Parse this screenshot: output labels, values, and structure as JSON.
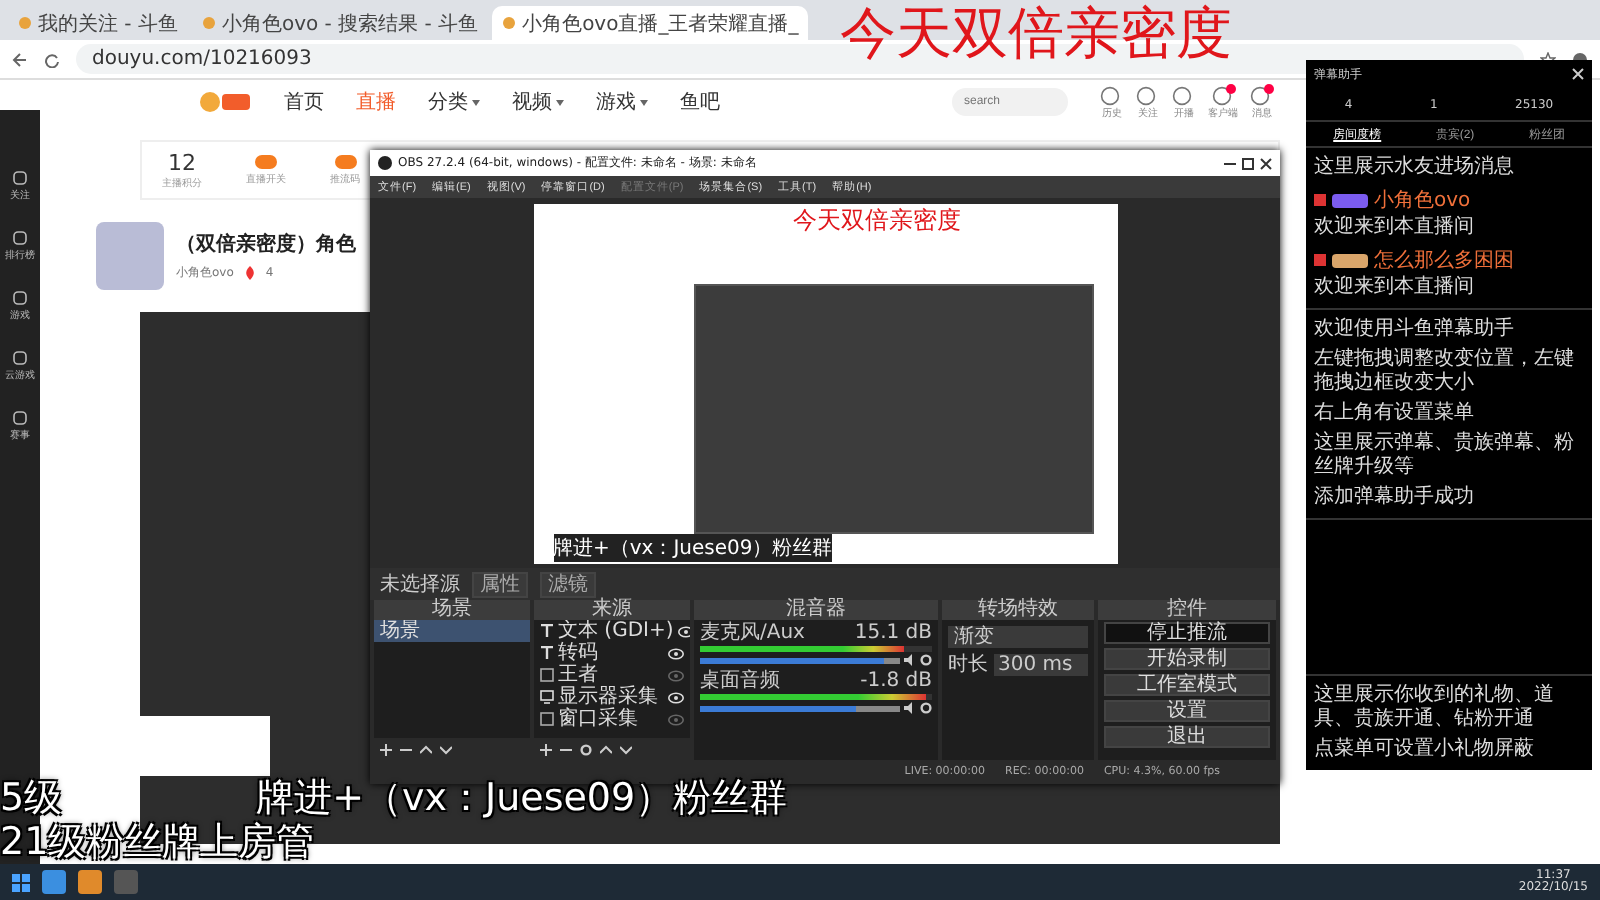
{
  "browser": {
    "tabs": [
      {
        "label": "我的关注 - 斗鱼",
        "selected": false
      },
      {
        "label": "小角色ovo - 搜索结果 - 斗鱼",
        "selected": false
      },
      {
        "label": "小角色ovo直播_王者荣耀直播_",
        "selected": true
      }
    ],
    "address": "douyu.com/10216093"
  },
  "overlay_title": "今天双倍亲密度",
  "site": {
    "nav": [
      {
        "label": "首页",
        "selected": false,
        "kind": "link"
      },
      {
        "label": "直播",
        "selected": true,
        "kind": "link"
      },
      {
        "label": "分类",
        "selected": false,
        "kind": "menu"
      },
      {
        "label": "视频",
        "selected": false,
        "kind": "menu"
      },
      {
        "label": "游戏",
        "selected": false,
        "kind": "menu"
      },
      {
        "label": "鱼吧",
        "selected": false,
        "kind": "link"
      }
    ],
    "search": {
      "placeholder": "search"
    },
    "header_icons": [
      {
        "label": "历史",
        "badge": false
      },
      {
        "label": "关注",
        "badge": false
      },
      {
        "label": "开播",
        "badge": false
      },
      {
        "label": "客户端",
        "badge": true
      },
      {
        "label": "消息",
        "badge": true
      }
    ],
    "sidebar": [
      "关注",
      "排行榜",
      "游戏",
      "云游戏",
      "赛事"
    ],
    "score": {
      "value": "12",
      "label": "主播积分"
    },
    "tools": [
      "直播开关",
      "推流码"
    ],
    "streamer": {
      "title": "（双倍亲密度）角色",
      "name": "小角色ovo",
      "hot": "4"
    }
  },
  "chat": {
    "title": "弹幕助手",
    "stats": [
      "4",
      "1",
      "25130"
    ],
    "tabs": [
      {
        "label": "房间度榜",
        "selected": true
      },
      {
        "label": "贵宾(2)",
        "selected": false
      },
      {
        "label": "粉丝团",
        "selected": false
      }
    ],
    "enter_header": "这里展示水友进场消息",
    "entries": [
      {
        "user": "小角色ovo",
        "text": "欢迎来到本直播间",
        "color": "#7b5cf0"
      },
      {
        "user": "怎么那么多困困",
        "text": "欢迎来到本直播间",
        "color": "#d9a56a"
      }
    ],
    "system": [
      "欢迎使用斗鱼弹幕助手",
      "左键拖拽调整改变位置，左键拖拽边框改变大小",
      "右上角有设置菜单",
      "这里展示弹幕、贵族弹幕、粉丝牌升级等",
      "添加弹幕助手成功"
    ],
    "gifts": [
      "这里展示你收到的礼物、道具、贵族开通、钻粉开通",
      "点菜单可设置小礼物屏蔽"
    ]
  },
  "obs": {
    "title": "OBS 27.2.4 (64-bit, windows) - 配置文件: 未命名 - 场景: 未命名",
    "menu": [
      {
        "label": "文件(F)",
        "disabled": false
      },
      {
        "label": "编辑(E)",
        "disabled": false
      },
      {
        "label": "视图(V)",
        "disabled": false
      },
      {
        "label": "停靠窗口(D)",
        "disabled": false
      },
      {
        "label": "配置文件(P)",
        "disabled": true
      },
      {
        "label": "场景集合(S)",
        "disabled": false
      },
      {
        "label": "工具(T)",
        "disabled": false
      },
      {
        "label": "帮助(H)",
        "disabled": false
      }
    ],
    "preview_texts": [
      "今天双倍亲密度",
      "牌进+（vx：Juese09）粉丝群"
    ],
    "no_source": "未选择源",
    "source_buttons": [
      "属性",
      "滤镜"
    ],
    "docks": [
      "场景",
      "来源",
      "混音器",
      "转场特效",
      "控件"
    ],
    "scenes": [
      {
        "label": "场景",
        "selected": true
      }
    ],
    "sources": [
      {
        "label": "文本 (GDI+)",
        "kind": "text",
        "visible": true
      },
      {
        "label": "转码",
        "kind": "text",
        "visible": true
      },
      {
        "label": "王者",
        "kind": "window",
        "visible": false
      },
      {
        "label": "显示器采集",
        "kind": "monitor",
        "visible": true
      },
      {
        "label": "窗口采集",
        "kind": "window",
        "visible": false
      }
    ],
    "mixer": [
      {
        "name": "麦克风/Aux",
        "reading": "15.1 dB",
        "meter": {
          "level": 0.88
        },
        "volume": {
          "level": 0.92
        }
      },
      {
        "name": "桌面音频",
        "reading": "-1.8 dB",
        "meter": {
          "level": 0.97
        },
        "volume": {
          "level": 0.78
        }
      }
    ],
    "transition": {
      "value": "渐变",
      "duration_label": "时长",
      "duration": "300 ms"
    },
    "controls": [
      {
        "label": "停止推流",
        "active": true
      },
      {
        "label": "开始录制",
        "active": false
      },
      {
        "label": "工作室模式",
        "active": false
      },
      {
        "label": "设置",
        "active": false
      },
      {
        "label": "退出",
        "active": false
      }
    ],
    "status": [
      "LIVE: 00:00:00",
      "REC: 00:00:00",
      "CPU: 4.3%, 60.00 fps"
    ]
  },
  "overlay_lines": [
    [
      "5级",
      "牌进+（vx：Juese09）粉丝群"
    ],
    [
      "21级粉丝牌上房管"
    ]
  ],
  "taskbar": {
    "time": "11:37",
    "date": "2022/10/15"
  }
}
